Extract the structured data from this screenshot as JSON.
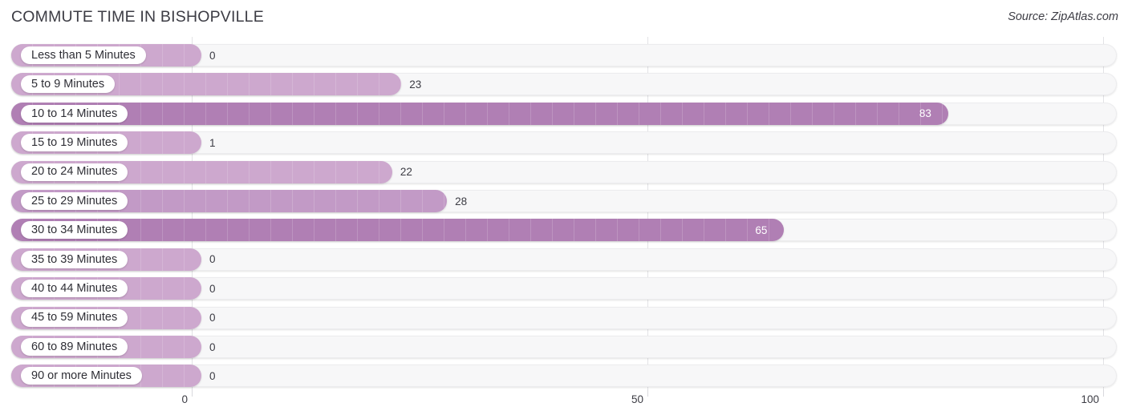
{
  "header": {
    "title": "COMMUTE TIME IN BISHOPVILLE",
    "source": "Source: ZipAtlas.com"
  },
  "colors": {
    "bar_light": "#cda8ce",
    "bar_mid": "#c29ac6",
    "bar_dark": "#b07fb4",
    "track": "#f7f7f8",
    "gridline": "#e3e3e6",
    "text": "#3c3c44",
    "value_inside": "#ffffff"
  },
  "chart_data": {
    "type": "bar",
    "orientation": "horizontal",
    "title": "COMMUTE TIME IN BISHOPVILLE",
    "xlabel": "",
    "ylabel": "",
    "xlim": [
      0,
      100
    ],
    "grid": true,
    "legend": null,
    "xticks": [
      "0",
      "50",
      "100"
    ],
    "xtick_values": [
      0,
      50,
      100
    ],
    "categories": [
      "Less than 5 Minutes",
      "5 to 9 Minutes",
      "10 to 14 Minutes",
      "15 to 19 Minutes",
      "20 to 24 Minutes",
      "25 to 29 Minutes",
      "30 to 34 Minutes",
      "35 to 39 Minutes",
      "40 to 44 Minutes",
      "45 to 59 Minutes",
      "60 to 89 Minutes",
      "90 or more Minutes"
    ],
    "values": [
      0,
      23,
      83,
      1,
      22,
      28,
      65,
      0,
      0,
      0,
      0,
      0
    ],
    "value_labels": [
      "0",
      "23",
      "83",
      "1",
      "22",
      "28",
      "65",
      "0",
      "0",
      "0",
      "0",
      "0"
    ]
  }
}
